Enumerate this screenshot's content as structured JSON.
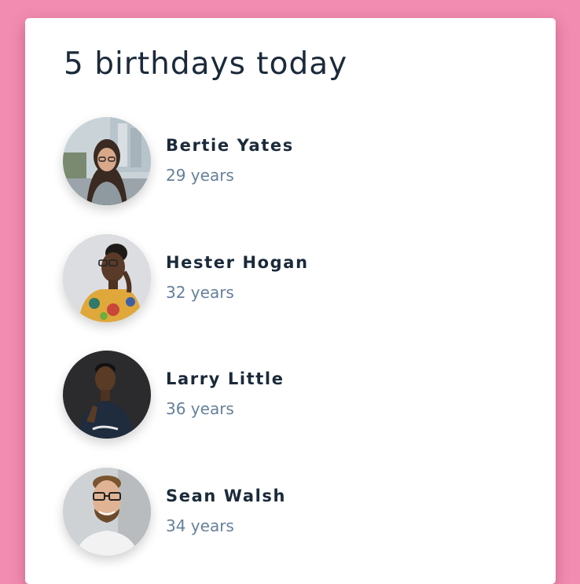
{
  "header": {
    "title": "5 birthdays today"
  },
  "people": [
    {
      "name": "Bertie Yates",
      "age": "29 years",
      "avatar_icon": "photo-woman-glasses-street"
    },
    {
      "name": "Hester Hogan",
      "age": "32 years",
      "avatar_icon": "photo-woman-floral-top"
    },
    {
      "name": "Larry Little",
      "age": "36 years",
      "avatar_icon": "photo-man-dark-tshirt"
    },
    {
      "name": "Sean Walsh",
      "age": "34 years",
      "avatar_icon": "photo-man-glasses-smiling"
    }
  ],
  "colors": {
    "background": "#f28cb0",
    "card": "#ffffff",
    "name_text": "#1b2a3a",
    "age_text": "#66809a"
  }
}
